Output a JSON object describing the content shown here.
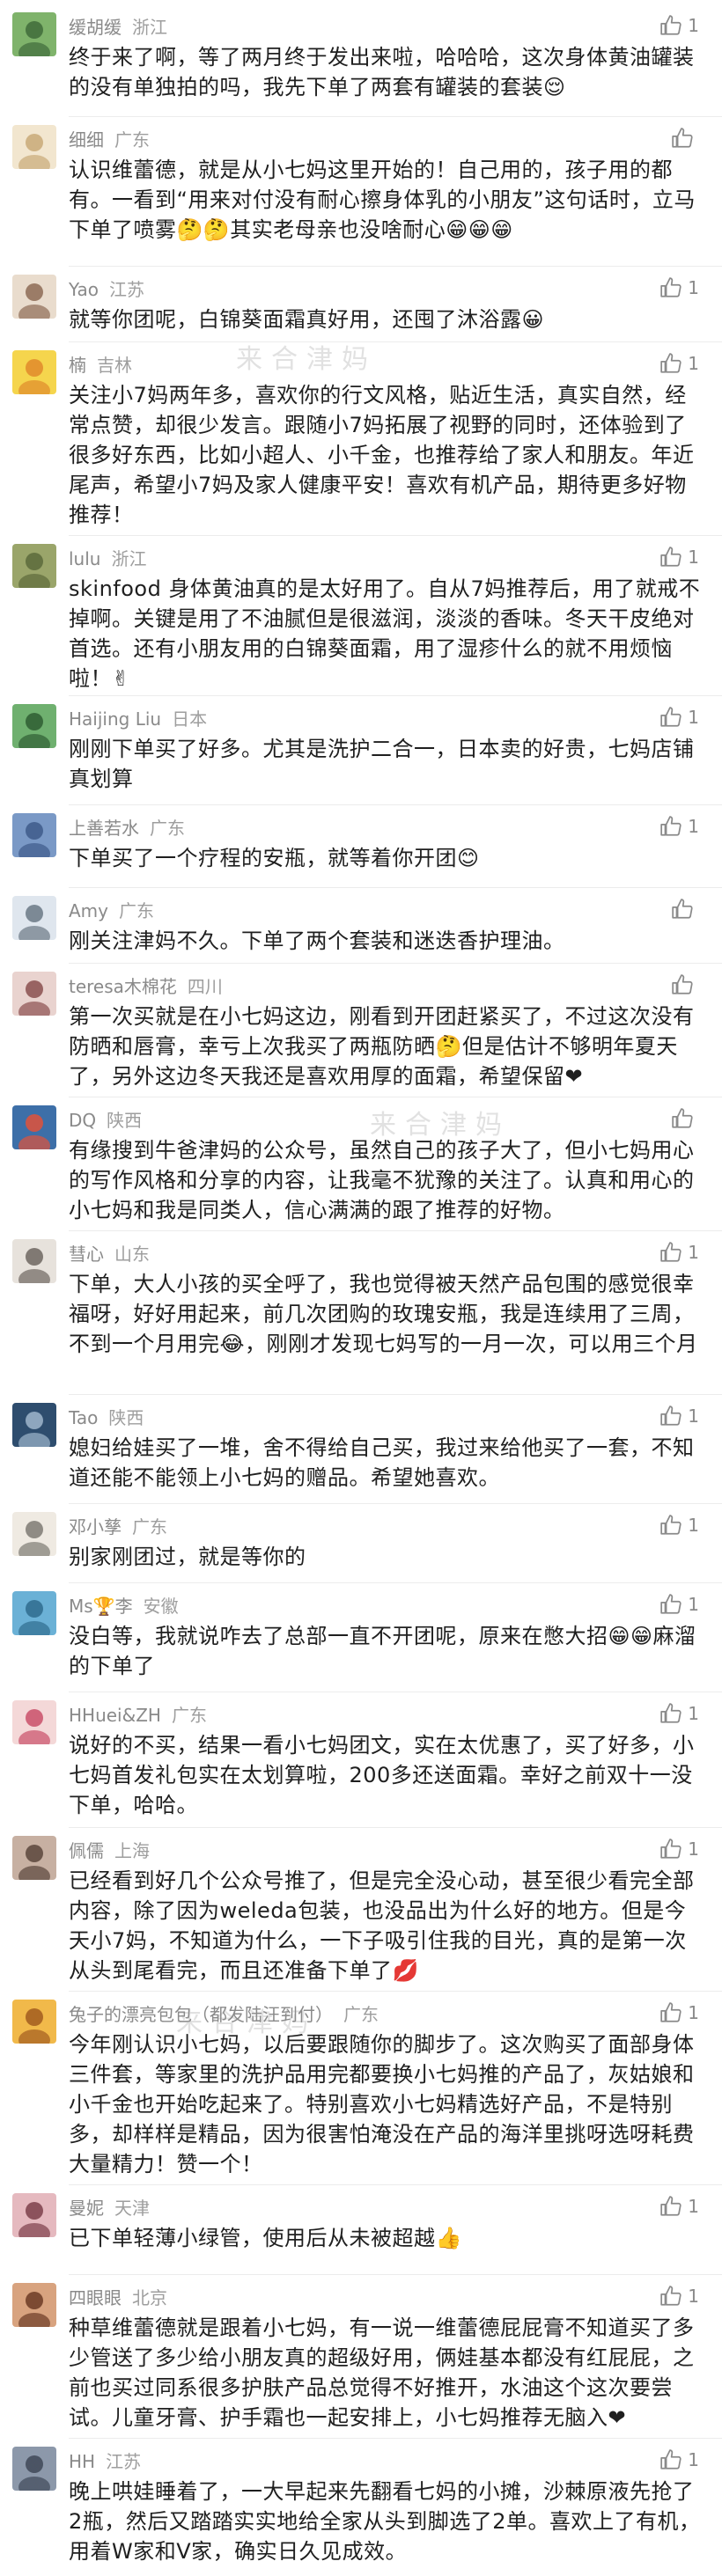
{
  "colors": {
    "text": "#1f1f1f",
    "meta": "#8a8a8a",
    "divider": "#ececec",
    "like_icon": "#8a8a8a",
    "background": "#ffffff"
  },
  "like_icon": "thumbs-up-icon",
  "watermark": "来合津妈",
  "comments": [
    {
      "user": "缓胡缓",
      "location": "浙江",
      "likes": "1",
      "text": "终于来了啊，等了两月终于发出来啦，哈哈哈，这次身体黄油罐装的没有单独拍的吗，我先下单了两套有罐装的套装😌"
    },
    {
      "user": "细细",
      "location": "广东",
      "likes": "",
      "text": "认识维蕾德，就是从小七妈这里开始的！自己用的，孩子用的都有。一看到“用来对付没有耐心擦身体乳的小朋友”这句话时，立马下单了喷雾🤔🤔其实老母亲也没啥耐心😁😁😁"
    },
    {
      "user": "Yao",
      "location": "江苏",
      "likes": "1",
      "text": "就等你团呢，白锦葵面霜真好用，还囤了沐浴露😀"
    },
    {
      "user": "楠",
      "location": "吉林",
      "likes": "1",
      "text": "关注小7妈两年多，喜欢你的行文风格，贴近生活，真实自然，经常点赞，却很少发言。跟随小7妈拓展了视野的同时，还体验到了很多好东西，比如小超人、小千金，也推荐给了家人和朋友。年近尾声，希望小7妈及家人健康平安！喜欢有机产品，期待更多好物推荐！"
    },
    {
      "user": "lulu",
      "location": "浙江",
      "likes": "1",
      "text": "skinfood 身体黄油真的是太好用了。自从7妈推荐后，用了就戒不掉啊。关键是用了不油腻但是很滋润，淡淡的香味。冬天干皮绝对首选。还有小朋友用的白锦葵面霜，用了湿疹什么的就不用烦恼啦！✌"
    },
    {
      "user": "Haijing Liu",
      "location": "日本",
      "likes": "1",
      "text": "刚刚下单买了好多。尤其是洗护二合一，日本卖的好贵，七妈店铺真划算"
    },
    {
      "user": "上善若水",
      "location": "广东",
      "likes": "1",
      "text": "下单买了一个疗程的安瓶，就等着你开团😊"
    },
    {
      "user": "Amy",
      "location": "广东",
      "likes": "",
      "text": "刚关注津妈不久。下单了两个套装和迷迭香护理油。"
    },
    {
      "user": "teresa木棉花",
      "location": "四川",
      "likes": "",
      "text": "第一次买就是在小七妈这边，刚看到开团赶紧买了，不过这次没有防晒和唇膏，幸亏上次我买了两瓶防晒🤔但是估计不够明年夏天了，另外这边冬天我还是喜欢用厚的面霜，希望保留❤"
    },
    {
      "user": "DQ",
      "location": "陕西",
      "likes": "",
      "text": "有缘搜到牛爸津妈的公众号，虽然自己的孩子大了，但小七妈用心的写作风格和分享的内容，让我毫不犹豫的关注了。认真和用心的小七妈和我是同类人，信心满满的跟了推荐的好物。"
    },
    {
      "user": "彗心",
      "location": "山东",
      "likes": "1",
      "text": "下单，大人小孩的买全呼了，我也觉得被天然产品包围的感觉很幸福呀，好好用起来，前几次团购的玫瑰安瓶，我是连续用了三周，不到一个月用完😂，刚刚才发现七妈写的一月一次，可以用三个月"
    },
    {
      "user": "Tao",
      "location": "陕西",
      "likes": "1",
      "text": "媳妇给娃买了一堆，舍不得给自己买，我过来给他买了一套，不知道还能不能领上小七妈的赠品。希望她喜欢。"
    },
    {
      "user": "邓小孳",
      "location": "广东",
      "likes": "1",
      "text": "别家刚团过，就是等你的"
    },
    {
      "user": "Ms🏆李",
      "location": "安徽",
      "likes": "1",
      "text": "没白等，我就说咋去了总部一直不开团呢，原来在憋大招😁😁麻溜的下单了"
    },
    {
      "user": "HHuei&ZH",
      "location": "广东",
      "likes": "1",
      "text": "说好的不买，结果一看小七妈团文，实在太优惠了，买了好多，小七妈首发礼包实在太划算啦，200多还送面霜。幸好之前双十一没下单，哈哈。"
    },
    {
      "user": "佩儒",
      "location": "上海",
      "likes": "1",
      "text": "已经看到好几个公众号推了，但是完全没心动，甚至很少看完全部内容，除了因为weleda包装，也没品出为什么好的地方。但是今天小7妈，不知道为什么，一下子吸引住我的目光，真的是第一次从头到尾看完，而且还准备下单了💋"
    },
    {
      "user": "兔子的漂亮包包（都发陆汪到付）",
      "location": "广东",
      "likes": "1",
      "text": "今年刚认识小七妈，以后要跟随你的脚步了。这次购买了面部身体三件套，等家里的洗护品用完都要换小七妈推的产品了，灰姑娘和小千金也开始吃起来了。特别喜欢小七妈精选好产品，不是特别多，却样样是精品，因为很害怕淹没在产品的海洋里挑呀选呀耗费大量精力！赞一个！"
    },
    {
      "user": "曼妮",
      "location": "天津",
      "likes": "1",
      "text": "已下单轻薄小绿管，使用后从未被超越👍"
    },
    {
      "user": "四眼眼",
      "location": "北京",
      "likes": "1",
      "text": "种草维蕾德就是跟着小七妈，有一说一维蕾德屁屁膏不知道买了多少管送了多少给小朋友真的超级好用，俩娃基本都没有红屁屁，之前也买过同系很多护肤产品总觉得不好推开，水油这个这次要尝试。儿童牙膏、护手霜也一起安排上，小七妈推荐无脑入❤"
    },
    {
      "user": "HH",
      "location": "江苏",
      "likes": "1",
      "text": "晚上哄娃睡着了，一大早起来先翻看七妈的小摊，沙棘原液先抢了2瓶，然后又踏踏实实地给全家从头到脚选了2单。喜欢上了有机，用着W家和V家，确实日久见成效。"
    }
  ]
}
